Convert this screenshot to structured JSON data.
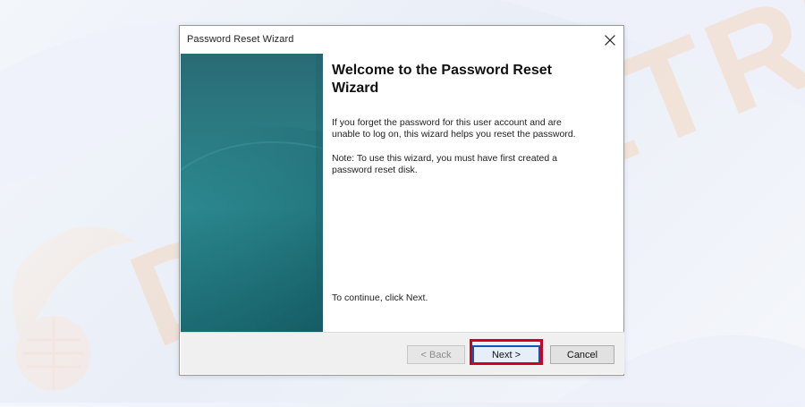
{
  "window": {
    "title": "Password Reset Wizard",
    "close_icon": "close-icon"
  },
  "wizard": {
    "heading_line1": "Welcome to the Password Reset",
    "heading_line2": "Wizard",
    "paragraph_1_line1": "If you forget the password for this user account and are",
    "paragraph_1_line2": "unable to log on, this wizard helps you reset the password.",
    "paragraph_2_line1": "Note: To use this wizard, you must have first created a",
    "paragraph_2_line2": "password reset disk.",
    "continue_text": "To continue, click Next."
  },
  "buttons": {
    "back_label": "< Back",
    "next_label": "Next >",
    "cancel_label": "Cancel"
  },
  "watermark": {
    "text": "DEVICETRICKS"
  },
  "colors": {
    "accent_blue": "#0b58b8",
    "highlight_red": "#d0021b",
    "teal_panel": "#2c8f95"
  }
}
